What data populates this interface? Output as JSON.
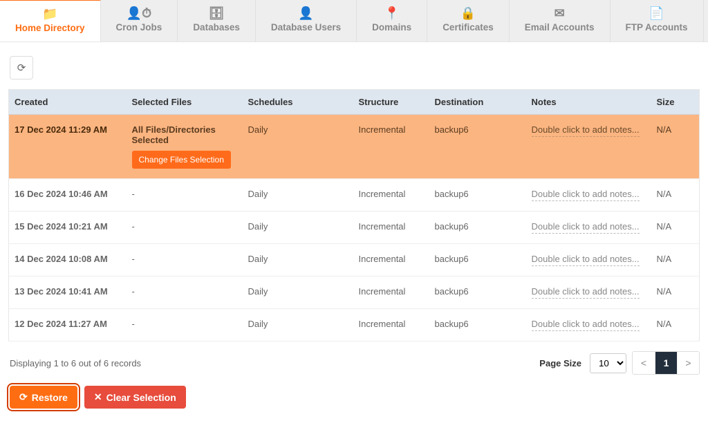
{
  "tabs": [
    {
      "label": "Home Directory",
      "icon": "📁",
      "active": true
    },
    {
      "label": "Cron Jobs",
      "icon": "👤⏱",
      "active": false
    },
    {
      "label": "Databases",
      "icon": "🗄",
      "active": false
    },
    {
      "label": "Database Users",
      "icon": "👤",
      "active": false
    },
    {
      "label": "Domains",
      "icon": "📍",
      "active": false
    },
    {
      "label": "Certificates",
      "icon": "🔒",
      "active": false
    },
    {
      "label": "Email Accounts",
      "icon": "✉",
      "active": false
    },
    {
      "label": "FTP Accounts",
      "icon": "📄",
      "active": false
    }
  ],
  "columns": {
    "created": "Created",
    "selected_files": "Selected Files",
    "schedules": "Schedules",
    "structure": "Structure",
    "destination": "Destination",
    "notes": "Notes",
    "size": "Size"
  },
  "rows": [
    {
      "created": "17 Dec 2024 11:29 AM",
      "files": "All Files/Directories Selected",
      "change_btn": "Change Files Selection",
      "schedules": "Daily",
      "structure": "Incremental",
      "destination": "backup6",
      "notes": "Double click to add notes...",
      "size": "N/A",
      "selected": true
    },
    {
      "created": "16 Dec 2024 10:46 AM",
      "files": "-",
      "schedules": "Daily",
      "structure": "Incremental",
      "destination": "backup6",
      "notes": "Double click to add notes...",
      "size": "N/A",
      "selected": false
    },
    {
      "created": "15 Dec 2024 10:21 AM",
      "files": "-",
      "schedules": "Daily",
      "structure": "Incremental",
      "destination": "backup6",
      "notes": "Double click to add notes...",
      "size": "N/A",
      "selected": false
    },
    {
      "created": "14 Dec 2024 10:08 AM",
      "files": "-",
      "schedules": "Daily",
      "structure": "Incremental",
      "destination": "backup6",
      "notes": "Double click to add notes...",
      "size": "N/A",
      "selected": false
    },
    {
      "created": "13 Dec 2024 10:41 AM",
      "files": "-",
      "schedules": "Daily",
      "structure": "Incremental",
      "destination": "backup6",
      "notes": "Double click to add notes...",
      "size": "N/A",
      "selected": false
    },
    {
      "created": "12 Dec 2024 11:27 AM",
      "files": "-",
      "schedules": "Daily",
      "structure": "Incremental",
      "destination": "backup6",
      "notes": "Double click to add notes...",
      "size": "N/A",
      "selected": false
    }
  ],
  "footer": {
    "summary": "Displaying 1 to 6 out of 6 records",
    "page_size_label": "Page Size",
    "page_size_value": "10",
    "page_options": [
      "10"
    ],
    "prev": "<",
    "current": "1",
    "next": ">"
  },
  "actions": {
    "restore": "Restore",
    "clear": "Clear Selection"
  }
}
